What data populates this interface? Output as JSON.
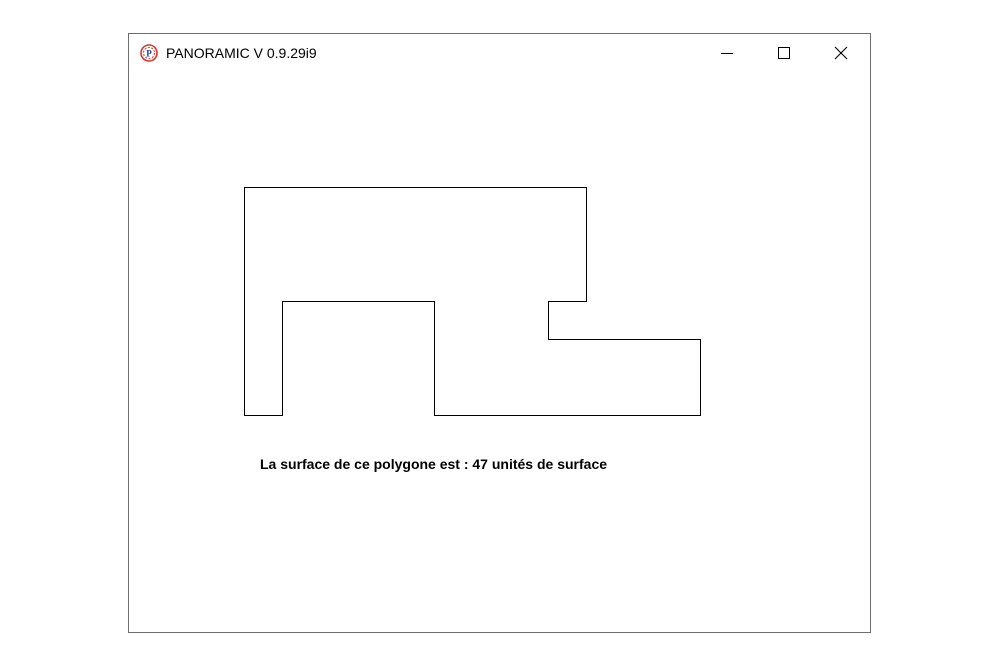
{
  "window": {
    "title": "PANORAMIC V 0.9.29i9",
    "app_icon": "panoramic-logo-icon",
    "controls": {
      "minimize_icon": "minimize-icon",
      "maximize_icon": "maximize-icon",
      "close_icon": "close-icon"
    }
  },
  "content": {
    "shape": "polygon",
    "message": "La surface de ce polygone est : 47 unités de surface"
  },
  "colors": {
    "stroke": "#000000",
    "background": "#ffffff",
    "icon_accent": "#d9342b"
  }
}
